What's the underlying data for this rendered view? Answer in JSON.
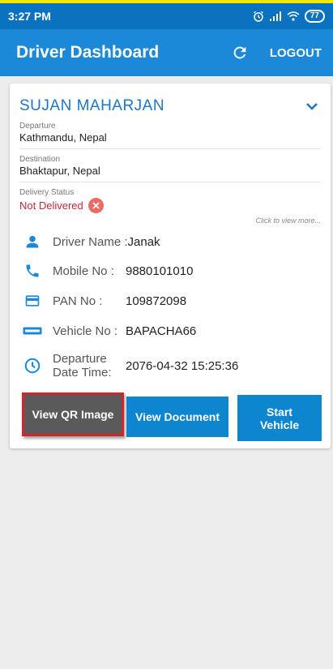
{
  "statusbar": {
    "time": "3:27 PM",
    "battery": "77"
  },
  "appbar": {
    "title": "Driver Dashboard",
    "logout_label": "LOGOUT"
  },
  "card": {
    "name": "SUJAN  MAHARJAN",
    "departure": {
      "label": "Departure",
      "value": "Kathmandu, Nepal"
    },
    "destination": {
      "label": "Destination",
      "value": "Bhaktapur, Nepal"
    },
    "delivery_status": {
      "label": "Delivery Status",
      "value": "Not Delivered"
    },
    "click_more": "Click to view more...",
    "driver_name": {
      "label": "Driver Name :",
      "value": "Janak"
    },
    "mobile": {
      "label": "Mobile No :",
      "value": "9880101010"
    },
    "pan": {
      "label": "PAN No :",
      "value": "109872098"
    },
    "vehicle": {
      "label": "Vehicle No :",
      "value": "BAPACHA66"
    },
    "departure_time": {
      "label_line1": "Departure",
      "label_line2": "Date Time:",
      "value": "2076-04-32 15:25:36"
    }
  },
  "buttons": {
    "qr": "View QR Image",
    "document": "View Document",
    "start_line1": "Start",
    "start_line2": "Vehicle"
  },
  "colors": {
    "statusbar": "#0b72bf",
    "appbar": "#1b88d8",
    "button": "#0e85cf",
    "name": "#1b76c8",
    "not_delivered": "#c6283a",
    "highlight": "#d6222c"
  }
}
